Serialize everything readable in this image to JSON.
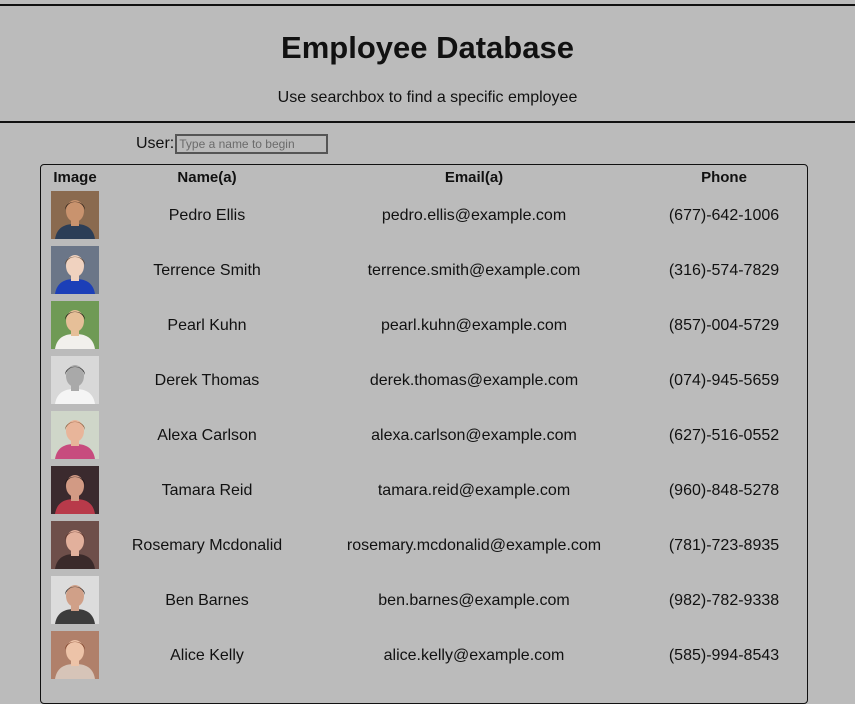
{
  "header": {
    "title": "Employee Database",
    "subtitle": "Use searchbox to find a specific employee"
  },
  "search": {
    "label": "User:",
    "placeholder": "Type a name to begin",
    "value": ""
  },
  "table": {
    "columns": [
      "Image",
      "Name(a)",
      "Email(a)",
      "Phone"
    ],
    "rows": [
      {
        "name": "Pedro Ellis",
        "email": "pedro.ellis@example.com",
        "phone": "(677)-642-1006",
        "photo": {
          "bg": "#8a6a4f",
          "skin": "#c9936e",
          "hair": "#2a1d14",
          "shirt": "#2c3e57"
        }
      },
      {
        "name": "Terrence Smith",
        "email": "terrence.smith@example.com",
        "phone": "(316)-574-7829",
        "photo": {
          "bg": "#6b7688",
          "skin": "#f0d2bf",
          "hair": "#5b4330",
          "shirt": "#1c3fb8"
        }
      },
      {
        "name": "Pearl Kuhn",
        "email": "pearl.kuhn@example.com",
        "phone": "(857)-004-5729",
        "photo": {
          "bg": "#6f9a55",
          "skin": "#e6bf98",
          "hair": "#1d140f",
          "shirt": "#f2f0ec"
        }
      },
      {
        "name": "Derek Thomas",
        "email": "derek.thomas@example.com",
        "phone": "(074)-945-5659",
        "photo": {
          "bg": "#d8d8d8",
          "skin": "#a9a9a9",
          "hair": "#2b2b2b",
          "shirt": "#f5f5f5"
        }
      },
      {
        "name": "Alexa Carlson",
        "email": "alexa.carlson@example.com",
        "phone": "(627)-516-0552",
        "photo": {
          "bg": "#cfd6c9",
          "skin": "#e8b59a",
          "hair": "#8a5a3a",
          "shirt": "#c74c7e"
        }
      },
      {
        "name": "Tamara Reid",
        "email": "tamara.reid@example.com",
        "phone": "(960)-848-5278",
        "photo": {
          "bg": "#3b2a2e",
          "skin": "#d29a84",
          "hair": "#1a1012",
          "shirt": "#b83a4a"
        }
      },
      {
        "name": "Rosemary Mcdonalid",
        "email": "rosemary.mcdonalid@example.com",
        "phone": "(781)-723-8935",
        "photo": {
          "bg": "#6e4f4a",
          "skin": "#e2b09c",
          "hair": "#5a2e24",
          "shirt": "#3a2a2a"
        }
      },
      {
        "name": "Ben Barnes",
        "email": "ben.barnes@example.com",
        "phone": "(982)-782-9338",
        "photo": {
          "bg": "#dcdcdc",
          "skin": "#d0a088",
          "hair": "#2a2a2a",
          "shirt": "#3c3c3c"
        }
      },
      {
        "name": "Alice Kelly",
        "email": "alice.kelly@example.com",
        "phone": "(585)-994-8543",
        "photo": {
          "bg": "#b0806a",
          "skin": "#edc3a8",
          "hair": "#7a3b22",
          "shirt": "#d6c4b8"
        }
      }
    ]
  }
}
